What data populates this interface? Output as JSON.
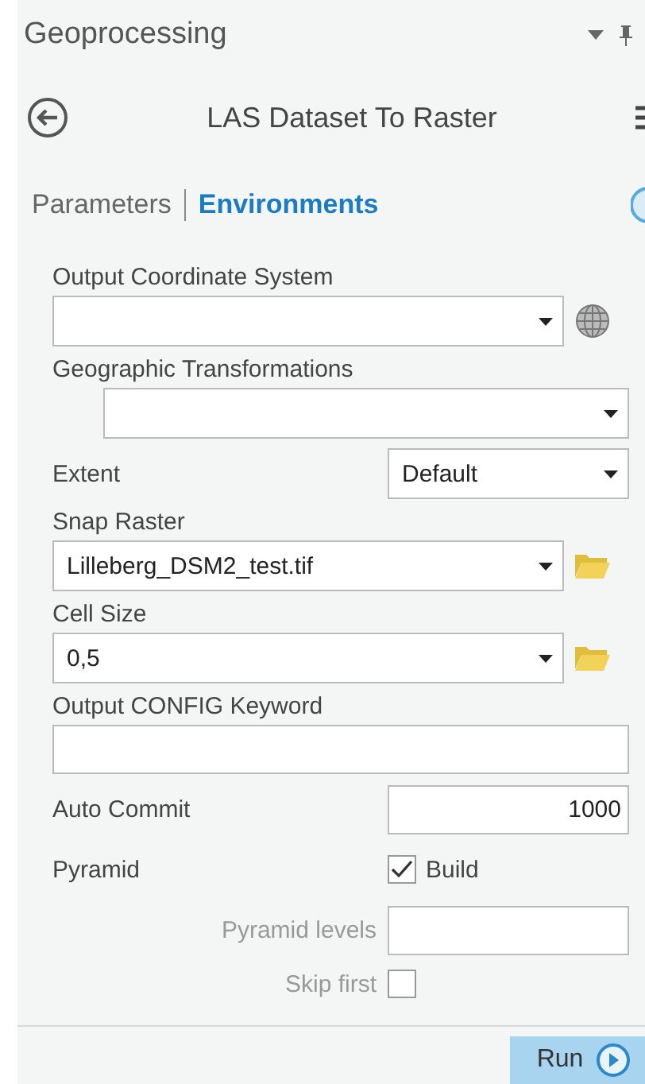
{
  "pane": {
    "title": "Geoprocessing"
  },
  "tool": {
    "title": "LAS Dataset To Raster"
  },
  "tabs": [
    {
      "label": "Parameters",
      "selected": false
    },
    {
      "label": "Environments",
      "selected": true
    }
  ],
  "fields": [
    {
      "kind": "combo-globe",
      "label": "Output Coordinate System"
    },
    {
      "kind": "combo-indent",
      "label": "Geographic Transformations"
    },
    {
      "kind": "inline-select",
      "label": "Extent",
      "value": "Default"
    },
    {
      "kind": "combo-browse",
      "label": "Snap Raster",
      "value": "Lilleberg_DSM2_test.tif"
    },
    {
      "kind": "combo-browse",
      "label": "Cell Size",
      "value": "0,5"
    },
    {
      "kind": "text",
      "label": "Output CONFIG Keyword"
    },
    {
      "kind": "inline-number",
      "label": "Auto Commit",
      "value": "1000"
    },
    {
      "kind": "inline-check",
      "label": "Pyramid",
      "option": "Build",
      "checked": true
    },
    {
      "kind": "sub-text",
      "label": "Pyramid levels"
    },
    {
      "kind": "sub-check",
      "label": "Skip first",
      "checked": false
    }
  ],
  "footer": {
    "run": "Run"
  }
}
